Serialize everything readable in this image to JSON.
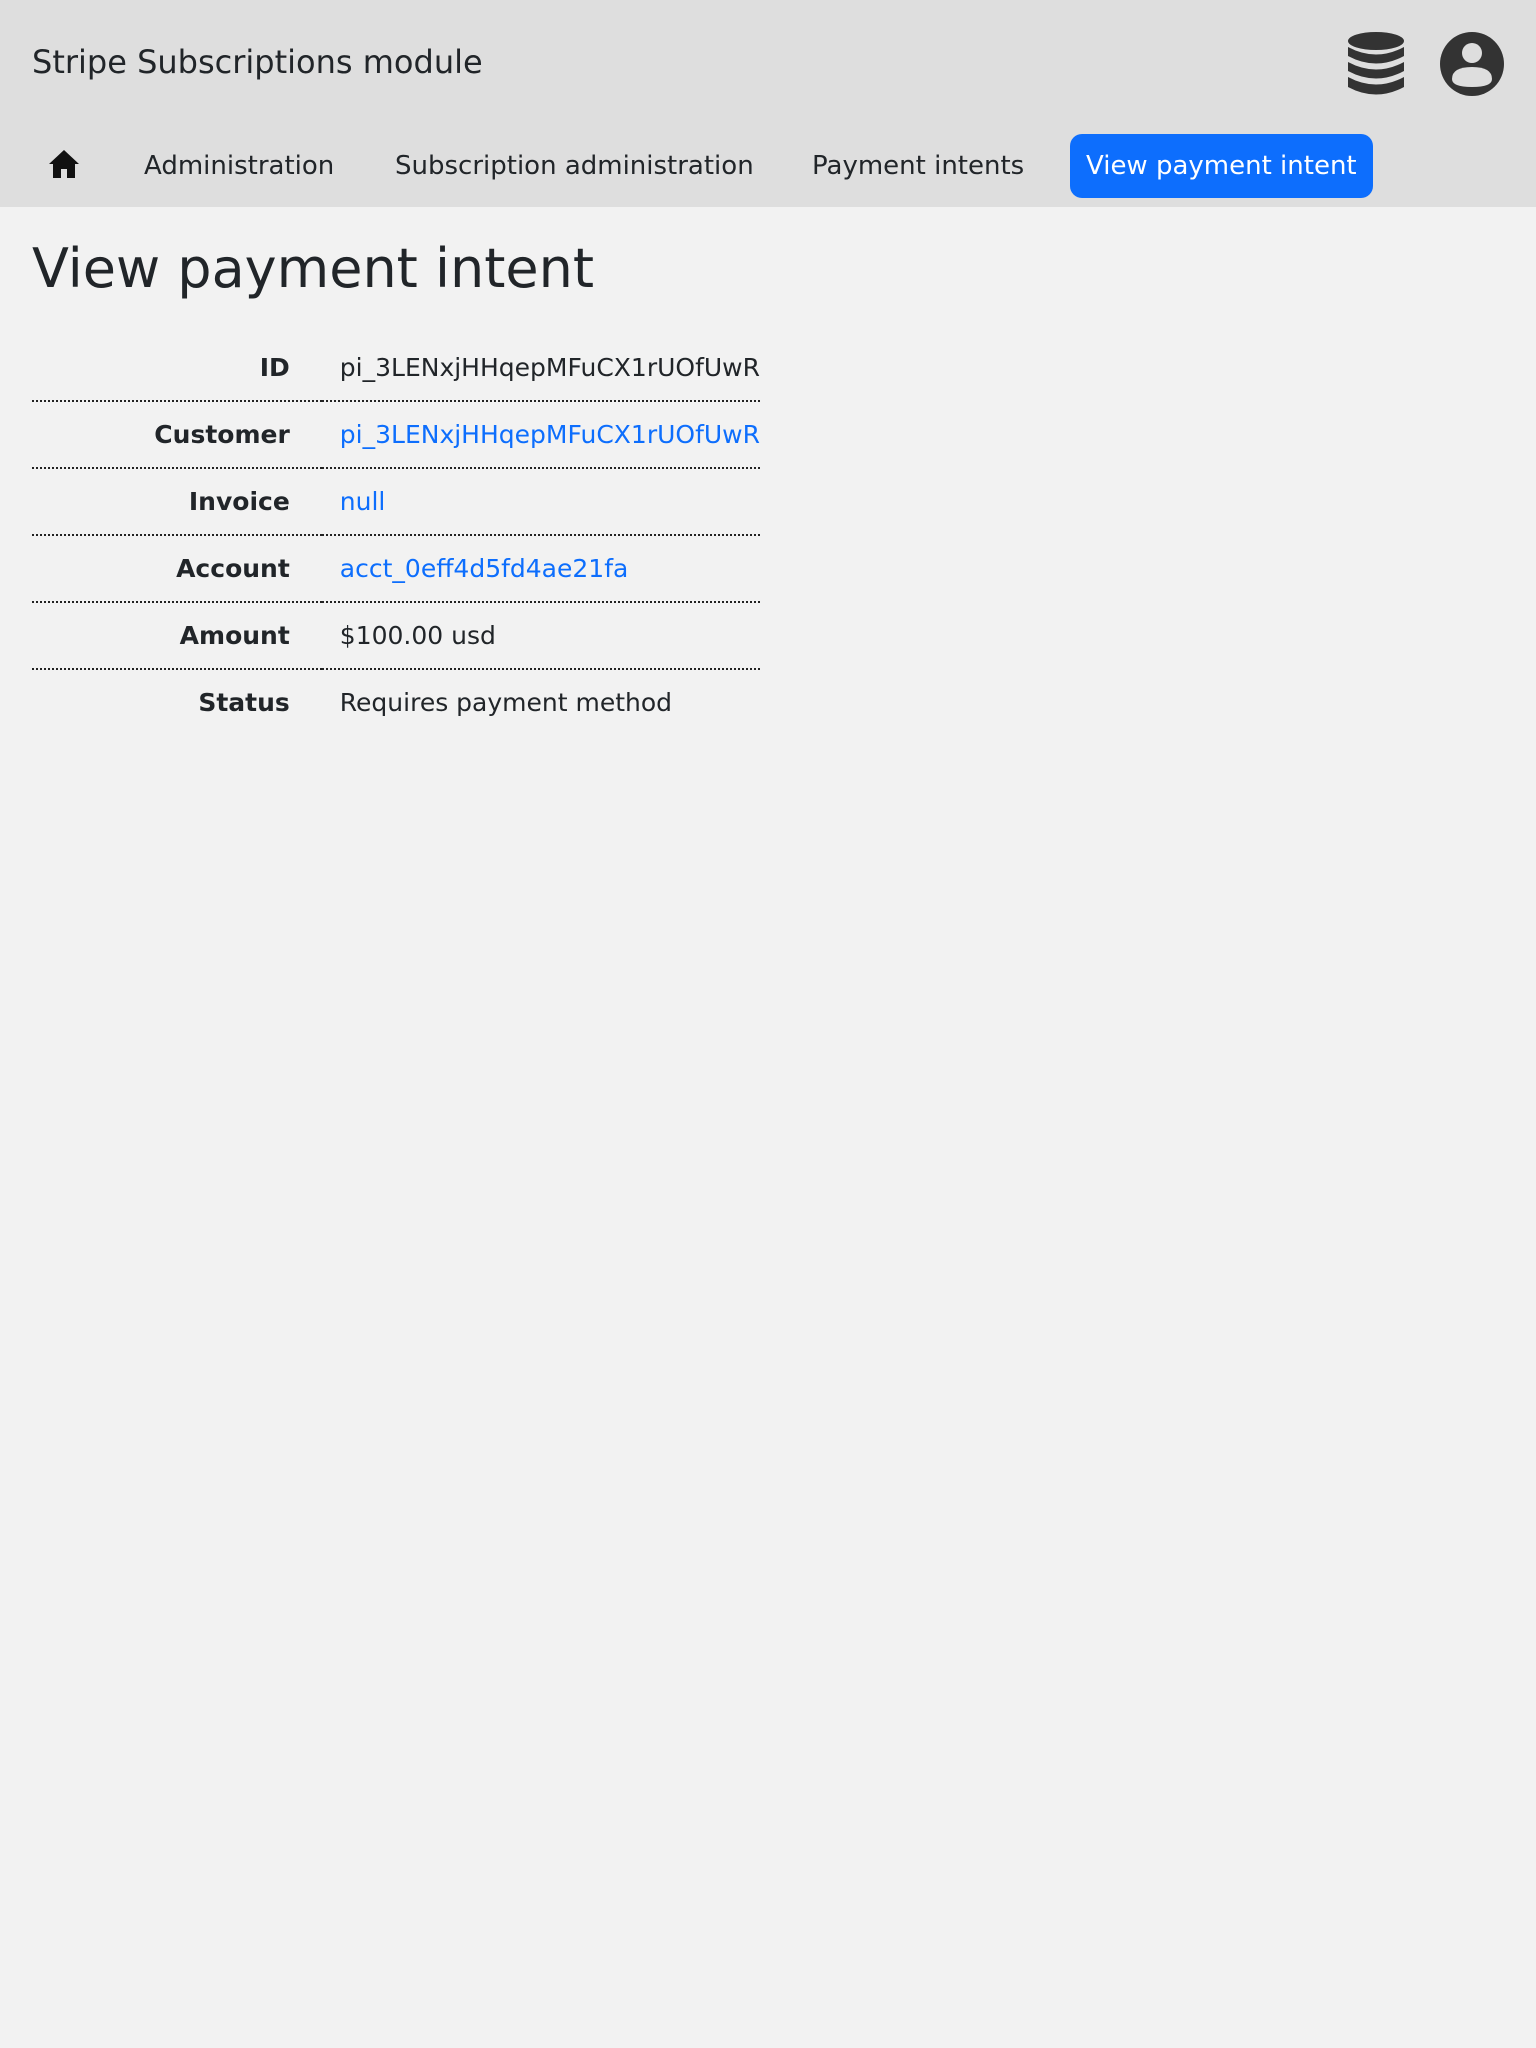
{
  "app": {
    "title": "Stripe Subscriptions module"
  },
  "header": {
    "icons": [
      "database-icon",
      "account-circle-icon"
    ]
  },
  "nav": {
    "home_icon": "home-icon",
    "items": [
      {
        "label": "Administration"
      },
      {
        "label": "Subscription administration"
      },
      {
        "label": "Payment intents"
      },
      {
        "label": "View payment intent",
        "active": true
      }
    ]
  },
  "page": {
    "title": "View payment intent"
  },
  "details": {
    "rows": [
      {
        "label": "ID",
        "value": "pi_3LENxjHHqepMFuCX1rUOfUwR",
        "link": false
      },
      {
        "label": "Customer",
        "value": "pi_3LENxjHHqepMFuCX1rUOfUwR",
        "link": true
      },
      {
        "label": "Invoice",
        "value": "null",
        "link": true
      },
      {
        "label": "Account",
        "value": "acct_0eff4d5fd4ae21fa",
        "link": true
      },
      {
        "label": "Amount",
        "value": "$100.00 usd",
        "link": false
      },
      {
        "label": "Status",
        "value": "Requires payment method",
        "link": false
      }
    ]
  },
  "colors": {
    "accent": "#0d6efd",
    "header_bg": "#dedede",
    "page_bg": "#f2f2f2",
    "icon": "#333333"
  }
}
